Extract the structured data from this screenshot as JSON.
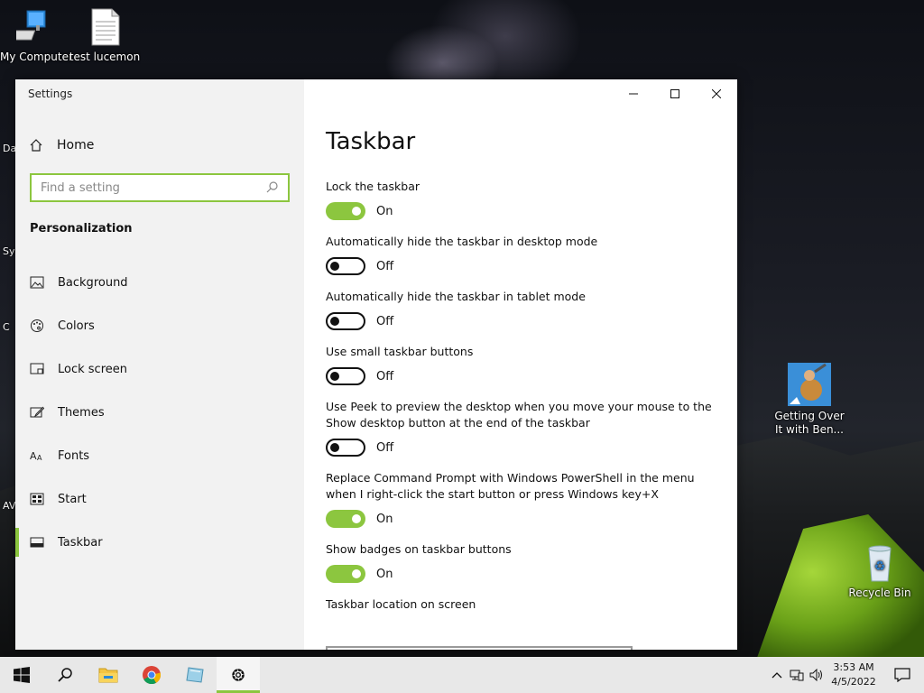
{
  "desktop": {
    "icons": [
      {
        "label": "My Computer"
      },
      {
        "label": "test lucemon"
      },
      {
        "label": "Getting Over It with Ben..."
      },
      {
        "label": "Recycle Bin"
      }
    ],
    "edge_labels": [
      "Da",
      "Sys",
      "C",
      "AV"
    ]
  },
  "window": {
    "title": "Settings",
    "nav": {
      "home_label": "Home",
      "search_placeholder": "Find a setting",
      "section": "Personalization",
      "items": [
        {
          "label": "Background",
          "icon": "image-icon"
        },
        {
          "label": "Colors",
          "icon": "palette-icon"
        },
        {
          "label": "Lock screen",
          "icon": "lock-screen-icon"
        },
        {
          "label": "Themes",
          "icon": "brush-icon"
        },
        {
          "label": "Fonts",
          "icon": "fonts-icon"
        },
        {
          "label": "Start",
          "icon": "start-icon"
        },
        {
          "label": "Taskbar",
          "icon": "taskbar-icon",
          "active": true
        }
      ]
    },
    "content": {
      "title": "Taskbar",
      "settings": [
        {
          "label": "Lock the taskbar",
          "state": "On"
        },
        {
          "label": "Automatically hide the taskbar in desktop mode",
          "state": "Off"
        },
        {
          "label": "Automatically hide the taskbar in tablet mode",
          "state": "Off"
        },
        {
          "label": "Use small taskbar buttons",
          "state": "Off"
        },
        {
          "label": "Use Peek to preview the desktop when you move your mouse to the Show desktop button at the end of the taskbar",
          "state": "Off"
        },
        {
          "label": "Replace Command Prompt with Windows PowerShell in the menu when I right-click the start button or press Windows key+X",
          "state": "On"
        },
        {
          "label": "Show badges on taskbar buttons",
          "state": "On"
        }
      ],
      "next_label": "Taskbar location on screen"
    },
    "accent": "#8cc63f"
  },
  "taskbar": {
    "time": "3:53 AM",
    "date": "4/5/2022"
  }
}
